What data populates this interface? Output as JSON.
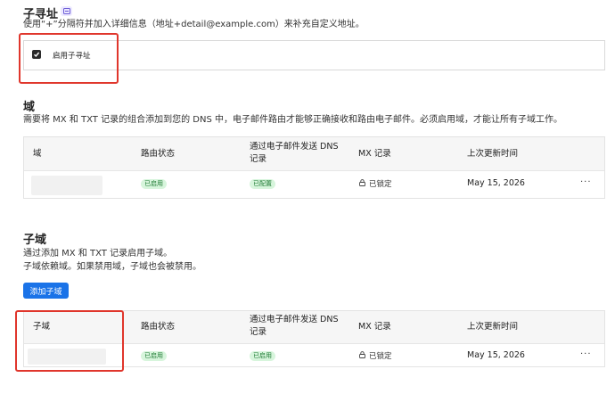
{
  "sub_address": {
    "title": "子寻址",
    "description": "使用“+”分隔符并加入详细信息（地址+detail@example.com）来补充自定义地址。",
    "checkbox_label": "启用子寻址",
    "checkbox_checked": true
  },
  "domains": {
    "title": "域",
    "description": "需要将 MX 和 TXT 记录的组合添加到您的 DNS 中，电子邮件路由才能够正确接收和路由电子邮件。必须启用域，才能让所有子域工作。",
    "columns": [
      "域",
      "路由状态",
      "通过电子邮件发送 DNS",
      "记录",
      "MX 记录",
      "上次更新时间"
    ],
    "rows": [
      {
        "domain": "",
        "routing_status": "已启用",
        "dns_status": "已配置",
        "mx": "已锁定",
        "updated": "May 15, 2026",
        "actions": "···"
      }
    ]
  },
  "subdomains": {
    "title": "子域",
    "description_line1": "通过添加 MX 和 TXT 记录启用子域。",
    "description_line2": "子域依赖域。如果禁用域，子域也会被禁用。",
    "add_button": "添加子域",
    "columns": [
      "子域",
      "路由状态",
      "通过电子邮件发送 DNS",
      "记录",
      "MX 记录",
      "上次更新时间"
    ],
    "rows": [
      {
        "subdomain": "",
        "routing_status": "已启用",
        "dns_status": "已启用",
        "mx": "已锁定",
        "updated": "May 15, 2026",
        "actions": "···"
      }
    ]
  },
  "colors": {
    "accent": "#1a73e8",
    "badge_bg": "#d7f5dc",
    "badge_text": "#1f7a34",
    "highlight": "#e0362c"
  }
}
